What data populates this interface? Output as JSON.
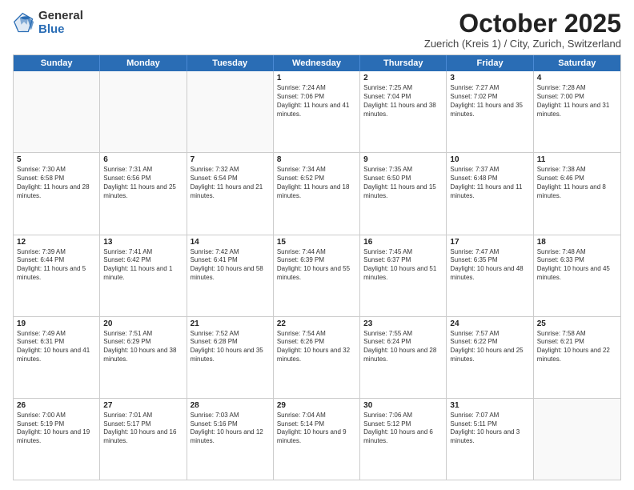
{
  "logo": {
    "general": "General",
    "blue": "Blue"
  },
  "title": {
    "month": "October 2025",
    "location": "Zuerich (Kreis 1) / City, Zurich, Switzerland"
  },
  "header_days": [
    "Sunday",
    "Monday",
    "Tuesday",
    "Wednesday",
    "Thursday",
    "Friday",
    "Saturday"
  ],
  "rows": [
    [
      {
        "day": "",
        "info": "",
        "empty": true
      },
      {
        "day": "",
        "info": "",
        "empty": true
      },
      {
        "day": "",
        "info": "",
        "empty": true
      },
      {
        "day": "1",
        "info": "Sunrise: 7:24 AM\nSunset: 7:06 PM\nDaylight: 11 hours and 41 minutes.",
        "empty": false
      },
      {
        "day": "2",
        "info": "Sunrise: 7:25 AM\nSunset: 7:04 PM\nDaylight: 11 hours and 38 minutes.",
        "empty": false
      },
      {
        "day": "3",
        "info": "Sunrise: 7:27 AM\nSunset: 7:02 PM\nDaylight: 11 hours and 35 minutes.",
        "empty": false
      },
      {
        "day": "4",
        "info": "Sunrise: 7:28 AM\nSunset: 7:00 PM\nDaylight: 11 hours and 31 minutes.",
        "empty": false
      }
    ],
    [
      {
        "day": "5",
        "info": "Sunrise: 7:30 AM\nSunset: 6:58 PM\nDaylight: 11 hours and 28 minutes.",
        "empty": false
      },
      {
        "day": "6",
        "info": "Sunrise: 7:31 AM\nSunset: 6:56 PM\nDaylight: 11 hours and 25 minutes.",
        "empty": false
      },
      {
        "day": "7",
        "info": "Sunrise: 7:32 AM\nSunset: 6:54 PM\nDaylight: 11 hours and 21 minutes.",
        "empty": false
      },
      {
        "day": "8",
        "info": "Sunrise: 7:34 AM\nSunset: 6:52 PM\nDaylight: 11 hours and 18 minutes.",
        "empty": false
      },
      {
        "day": "9",
        "info": "Sunrise: 7:35 AM\nSunset: 6:50 PM\nDaylight: 11 hours and 15 minutes.",
        "empty": false
      },
      {
        "day": "10",
        "info": "Sunrise: 7:37 AM\nSunset: 6:48 PM\nDaylight: 11 hours and 11 minutes.",
        "empty": false
      },
      {
        "day": "11",
        "info": "Sunrise: 7:38 AM\nSunset: 6:46 PM\nDaylight: 11 hours and 8 minutes.",
        "empty": false
      }
    ],
    [
      {
        "day": "12",
        "info": "Sunrise: 7:39 AM\nSunset: 6:44 PM\nDaylight: 11 hours and 5 minutes.",
        "empty": false
      },
      {
        "day": "13",
        "info": "Sunrise: 7:41 AM\nSunset: 6:42 PM\nDaylight: 11 hours and 1 minute.",
        "empty": false
      },
      {
        "day": "14",
        "info": "Sunrise: 7:42 AM\nSunset: 6:41 PM\nDaylight: 10 hours and 58 minutes.",
        "empty": false
      },
      {
        "day": "15",
        "info": "Sunrise: 7:44 AM\nSunset: 6:39 PM\nDaylight: 10 hours and 55 minutes.",
        "empty": false
      },
      {
        "day": "16",
        "info": "Sunrise: 7:45 AM\nSunset: 6:37 PM\nDaylight: 10 hours and 51 minutes.",
        "empty": false
      },
      {
        "day": "17",
        "info": "Sunrise: 7:47 AM\nSunset: 6:35 PM\nDaylight: 10 hours and 48 minutes.",
        "empty": false
      },
      {
        "day": "18",
        "info": "Sunrise: 7:48 AM\nSunset: 6:33 PM\nDaylight: 10 hours and 45 minutes.",
        "empty": false
      }
    ],
    [
      {
        "day": "19",
        "info": "Sunrise: 7:49 AM\nSunset: 6:31 PM\nDaylight: 10 hours and 41 minutes.",
        "empty": false
      },
      {
        "day": "20",
        "info": "Sunrise: 7:51 AM\nSunset: 6:29 PM\nDaylight: 10 hours and 38 minutes.",
        "empty": false
      },
      {
        "day": "21",
        "info": "Sunrise: 7:52 AM\nSunset: 6:28 PM\nDaylight: 10 hours and 35 minutes.",
        "empty": false
      },
      {
        "day": "22",
        "info": "Sunrise: 7:54 AM\nSunset: 6:26 PM\nDaylight: 10 hours and 32 minutes.",
        "empty": false
      },
      {
        "day": "23",
        "info": "Sunrise: 7:55 AM\nSunset: 6:24 PM\nDaylight: 10 hours and 28 minutes.",
        "empty": false
      },
      {
        "day": "24",
        "info": "Sunrise: 7:57 AM\nSunset: 6:22 PM\nDaylight: 10 hours and 25 minutes.",
        "empty": false
      },
      {
        "day": "25",
        "info": "Sunrise: 7:58 AM\nSunset: 6:21 PM\nDaylight: 10 hours and 22 minutes.",
        "empty": false
      }
    ],
    [
      {
        "day": "26",
        "info": "Sunrise: 7:00 AM\nSunset: 5:19 PM\nDaylight: 10 hours and 19 minutes.",
        "empty": false
      },
      {
        "day": "27",
        "info": "Sunrise: 7:01 AM\nSunset: 5:17 PM\nDaylight: 10 hours and 16 minutes.",
        "empty": false
      },
      {
        "day": "28",
        "info": "Sunrise: 7:03 AM\nSunset: 5:16 PM\nDaylight: 10 hours and 12 minutes.",
        "empty": false
      },
      {
        "day": "29",
        "info": "Sunrise: 7:04 AM\nSunset: 5:14 PM\nDaylight: 10 hours and 9 minutes.",
        "empty": false
      },
      {
        "day": "30",
        "info": "Sunrise: 7:06 AM\nSunset: 5:12 PM\nDaylight: 10 hours and 6 minutes.",
        "empty": false
      },
      {
        "day": "31",
        "info": "Sunrise: 7:07 AM\nSunset: 5:11 PM\nDaylight: 10 hours and 3 minutes.",
        "empty": false
      },
      {
        "day": "",
        "info": "",
        "empty": true
      }
    ]
  ]
}
